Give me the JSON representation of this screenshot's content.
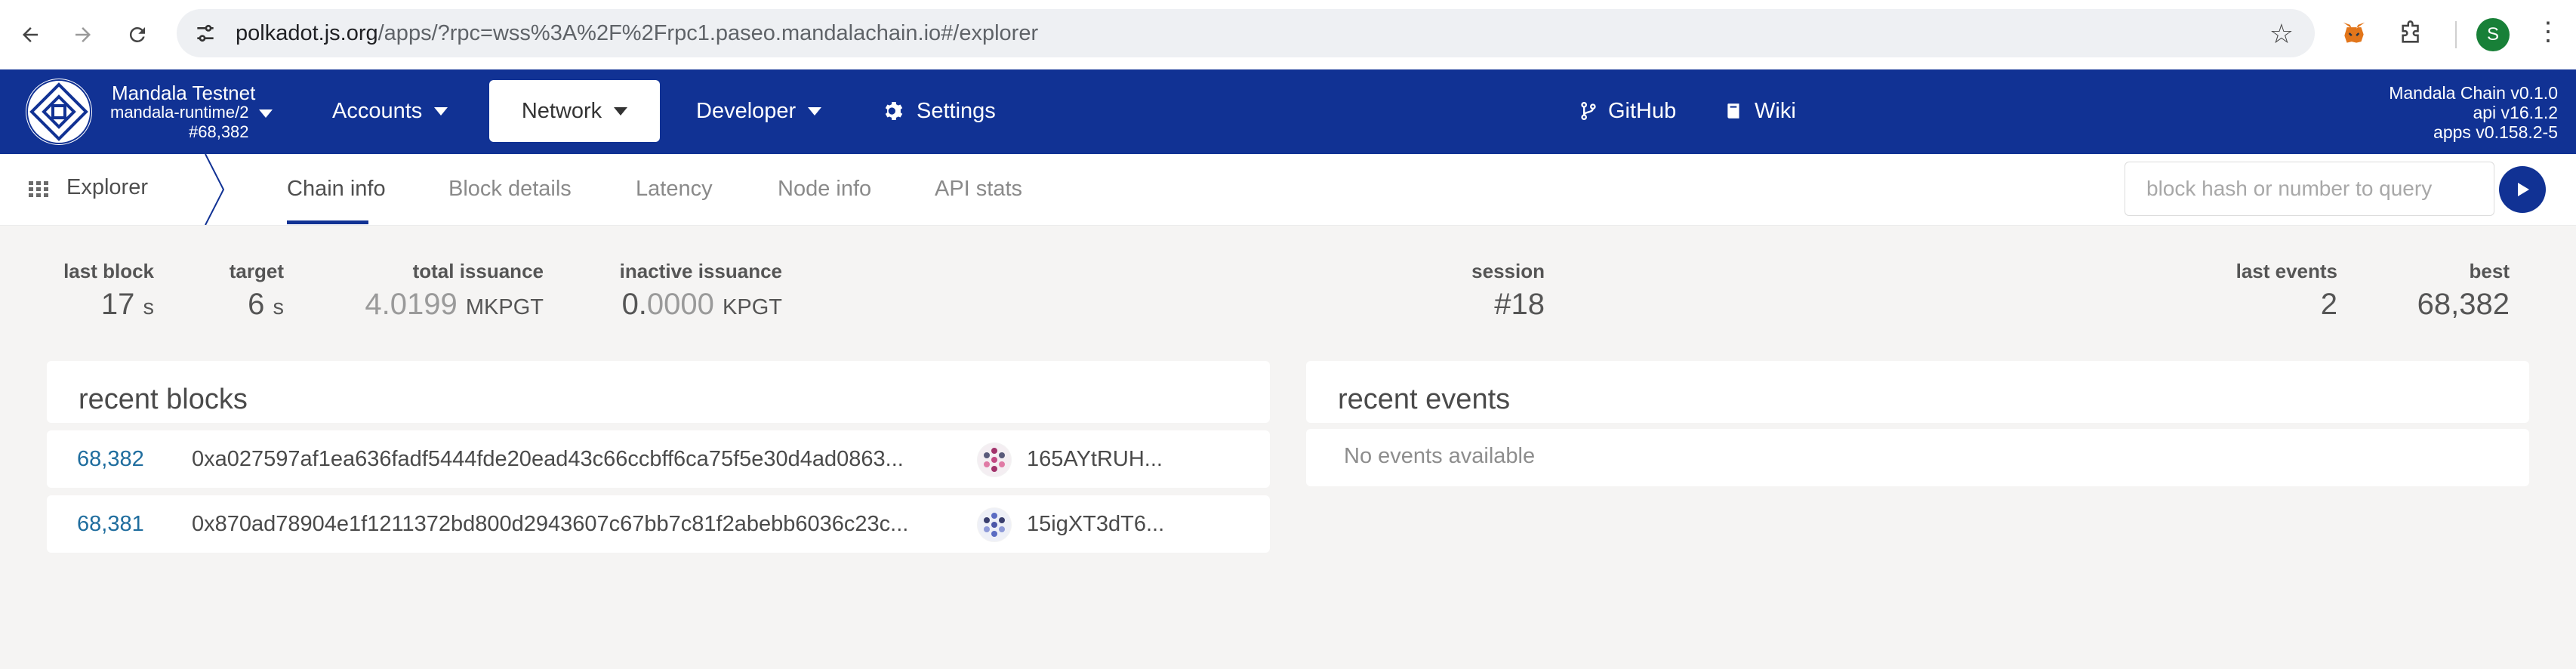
{
  "browser": {
    "url_host": "polkadot.js.org",
    "url_rest": "/apps/?rpc=wss%3A%2F%2Frpc1.paseo.mandalachain.io#/explorer",
    "profile_initial": "S"
  },
  "app": {
    "chain_name": "Mandala Testnet",
    "runtime": "mandala-runtime/2",
    "block_number": "#68,382",
    "nav": [
      {
        "label": "Accounts"
      },
      {
        "label": "Network"
      },
      {
        "label": "Developer"
      },
      {
        "label": "Settings"
      }
    ],
    "links": [
      {
        "label": "GitHub"
      },
      {
        "label": "Wiki"
      }
    ],
    "versions": [
      "Mandala Chain v0.1.0",
      "api v16.1.2",
      "apps v0.158.2-5"
    ]
  },
  "subnav": {
    "section": "Explorer",
    "tabs": [
      "Chain info",
      "Block details",
      "Latency",
      "Node info",
      "API stats"
    ],
    "search_placeholder": "block hash or number to query"
  },
  "stats": {
    "last_block": {
      "label": "last block",
      "value": "17",
      "unit": "s"
    },
    "target": {
      "label": "target",
      "value": "6",
      "unit": "s"
    },
    "total_issuance": {
      "label": "total issuance",
      "int": "4.",
      "frac": "0199",
      "unit": "MKPGT"
    },
    "inactive_issuance": {
      "label": "inactive issuance",
      "int": "0.",
      "frac": "0000",
      "unit": "KPGT"
    },
    "session": {
      "label": "session",
      "value": "#18"
    },
    "last_events": {
      "label": "last events",
      "value": "2"
    },
    "best": {
      "label": "best",
      "value": "68,382"
    }
  },
  "recent_blocks": {
    "title": "recent blocks",
    "rows": [
      {
        "number": "68,382",
        "hash": "0xa027597af1ea636fadf5444fde20ead43c66ccbff6ca75f5e30d4ad0863...",
        "author": "165AYtRUH..."
      },
      {
        "number": "68,381",
        "hash": "0x870ad78904e1f1211372bd800d2943607c67bb7c81f2abebb6036c23c...",
        "author": "15igXT3dT6..."
      }
    ]
  },
  "recent_events": {
    "title": "recent events",
    "empty_text": "No events available"
  }
}
